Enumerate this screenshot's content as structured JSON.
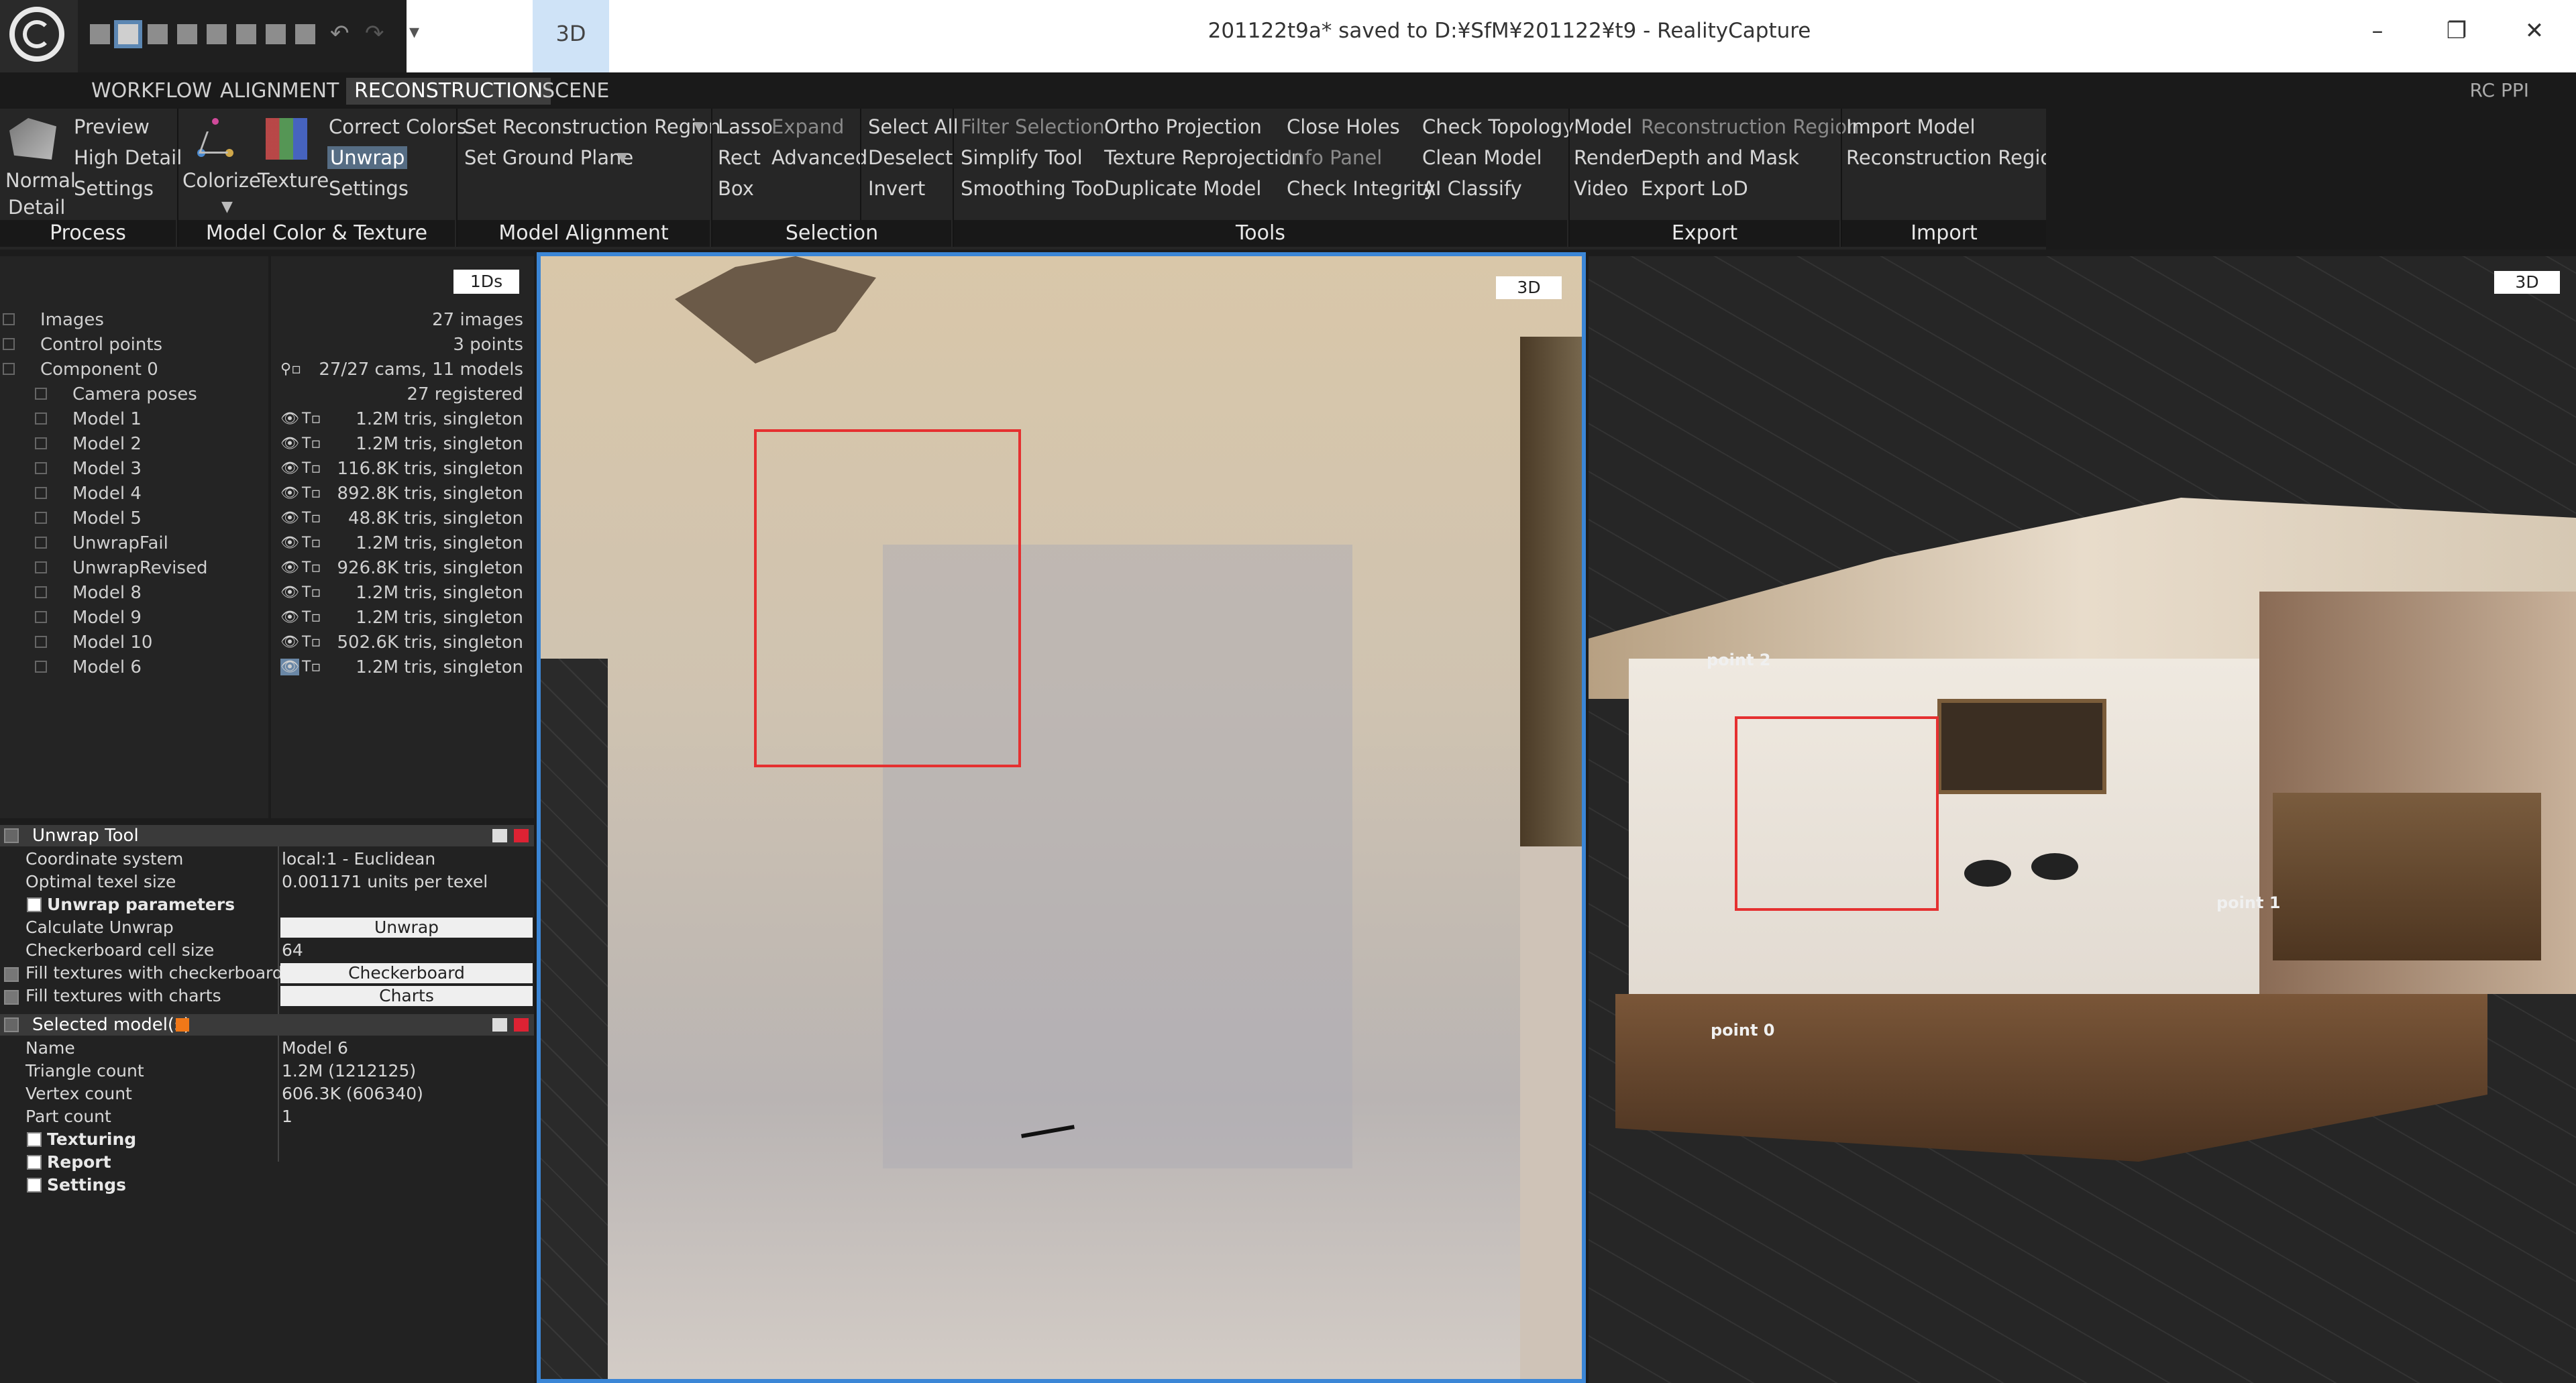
{
  "window": {
    "title": "201122t9a* saved to D:¥SfM¥201122¥t9 - RealityCapture",
    "tab_3d": "3D",
    "minimize": "–",
    "maximize": "❐",
    "close": "✕"
  },
  "menu": {
    "tabs": [
      "WORKFLOW",
      "ALIGNMENT",
      "RECONSTRUCTION",
      "SCENE"
    ],
    "active": "RECONSTRUCTION",
    "rc_ppi": "RC PPI"
  },
  "ribbon": {
    "process": {
      "normal_detail_1": "Normal",
      "normal_detail_2": "Detail",
      "preview": "Preview",
      "high_detail": "High Detail",
      "settings": "Settings",
      "label": "Process"
    },
    "color": {
      "colorize": "Colorize",
      "texture": "Texture",
      "correct_colors": "Correct Colors",
      "unwrap": "Unwrap",
      "settings": "Settings",
      "label": "Model Color & Texture"
    },
    "alignment": {
      "set_recon_region": "Set Reconstruction Region",
      "set_ground_plane": "Set Ground Plane",
      "label": "Model Alignment"
    },
    "selection": {
      "lasso": "Lasso",
      "expand": "Expand",
      "rect": "Rect",
      "advanced": "Advanced",
      "box": "Box",
      "select_all": "Select All",
      "deselect": "Deselect",
      "invert": "Invert",
      "label": "Selection"
    },
    "tools": {
      "filter_selection": "Filter Selection",
      "simplify_tool": "Simplify Tool",
      "smoothing_tool": "Smoothing Tool",
      "ortho": "Ortho Projection",
      "texture_reproj": "Texture Reprojection",
      "duplicate_model": "Duplicate Model",
      "close_holes": "Close Holes",
      "info_panel": "Info Panel",
      "check_integrity": "Check Integrity",
      "check_topology": "Check Topology",
      "clean_model": "Clean Model",
      "ai_classify": "AI Classify",
      "label": "Tools"
    },
    "export": {
      "model": "Model",
      "render": "Render",
      "video": "Video",
      "recon_region": "Reconstruction Region",
      "depth_mask": "Depth and Mask",
      "export_lod": "Export LoD",
      "label": "Export"
    },
    "import": {
      "import_model": "Import Model",
      "recon_region": "Reconstruction Region",
      "label": "Import"
    }
  },
  "tree": {
    "items": [
      {
        "label": "Images",
        "indent": 0
      },
      {
        "label": "Control points",
        "indent": 0
      },
      {
        "label": "Component 0",
        "indent": 0,
        "expanded": true
      },
      {
        "label": "Camera poses",
        "indent": 1
      },
      {
        "label": "Model 1",
        "indent": 1
      },
      {
        "label": "Model 2",
        "indent": 1
      },
      {
        "label": "Model 3",
        "indent": 1
      },
      {
        "label": "Model 4",
        "indent": 1
      },
      {
        "label": "Model 5",
        "indent": 1
      },
      {
        "label": "UnwrapFail",
        "indent": 1
      },
      {
        "label": "UnwrapRevised",
        "indent": 1
      },
      {
        "label": "Model 8",
        "indent": 1
      },
      {
        "label": "Model 9",
        "indent": 1
      },
      {
        "label": "Model 10",
        "indent": 1
      },
      {
        "label": "Model 6",
        "indent": 1
      }
    ]
  },
  "info": {
    "button_1ds": "1Ds",
    "rows": [
      "27 images",
      "3 points",
      "27/27 cams, 11 models",
      "27 registered",
      "1.2M tris, singleton",
      "1.2M tris, singleton",
      "116.8K tris, singleton",
      "892.8K tris, singleton",
      "48.8K tris, singleton",
      "1.2M tris, singleton",
      "926.8K tris, singleton",
      "1.2M tris, singleton",
      "1.2M tris, singleton",
      "502.6K tris, singleton",
      "1.2M tris, singleton"
    ]
  },
  "unwrap_tool": {
    "title": "Unwrap Tool",
    "coordinate_system_k": "Coordinate system",
    "coordinate_system_v": "local:1 - Euclidean",
    "optimal_texel_k": "Optimal texel size",
    "optimal_texel_v": "0.001171 units per texel",
    "unwrap_params": "Unwrap parameters",
    "calc_unwrap_k": "Calculate Unwrap",
    "calc_unwrap_b": "Unwrap",
    "cell_size_k": "Checkerboard cell size",
    "cell_size_v": "64",
    "fill_checker_k": "Fill textures with checkerboard",
    "fill_checker_b": "Checkerboard",
    "fill_charts_k": "Fill textures with charts",
    "fill_charts_b": "Charts"
  },
  "selected_models": {
    "title": "Selected model(s)",
    "name_k": "Name",
    "name_v": "Model 6",
    "tri_k": "Triangle count",
    "tri_v": "1.2M (1212125)",
    "vert_k": "Vertex count",
    "vert_v": "606.3K (606340)",
    "part_k": "Part count",
    "part_v": "1",
    "texturing": "Texturing",
    "report": "Report",
    "settings": "Settings"
  },
  "viewports": {
    "left_badge": "3D",
    "right_badge": "3D",
    "points": [
      "point 0",
      "point 1",
      "point 2"
    ]
  }
}
